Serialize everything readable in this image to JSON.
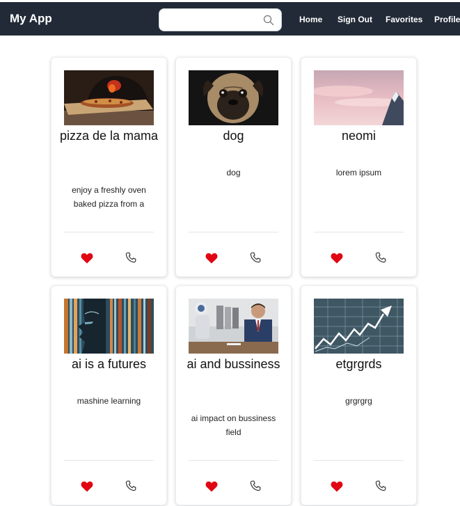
{
  "app": {
    "title": "My App"
  },
  "search": {
    "placeholder": "",
    "value": ""
  },
  "nav": {
    "home": "Home",
    "sign_out": "Sign Out",
    "favorites": "Favorites",
    "profile": "Profile"
  },
  "colors": {
    "navbar": "#212a36",
    "favorite": "#e10613",
    "card_border": "#eceef1"
  },
  "cards": [
    {
      "title": "pizza de la mama",
      "description": "enjoy a freshly oven baked pizza from a",
      "image": "pizza-oven",
      "favorited": true
    },
    {
      "title": "dog",
      "description": "dog",
      "image": "pug",
      "favorited": true
    },
    {
      "title": "neomi",
      "description": "lorem ipsum",
      "image": "pink-sky-mountain",
      "favorited": true
    },
    {
      "title": "ai is a futures",
      "description": "mashine learning",
      "image": "digital-face",
      "favorited": true
    },
    {
      "title": "ai and bussiness",
      "description": "ai impact on bussiness field",
      "image": "robots-office",
      "favorited": true
    },
    {
      "title": "etgrgrds",
      "description": "grgrgrg",
      "image": "stock-chart-arrow",
      "favorited": true
    }
  ]
}
